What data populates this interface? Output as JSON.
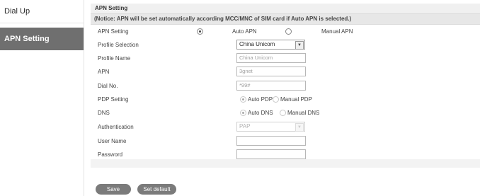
{
  "sidebar": {
    "items": [
      {
        "label": "Dial Up"
      },
      {
        "label": "APN Setting"
      }
    ]
  },
  "panel": {
    "title": "APN Setting",
    "notice": "(Notice: APN will be set automatically according MCC/MNC of SIM card if Auto APN is selected.)"
  },
  "form": {
    "apn_setting": {
      "label": "APN Setting",
      "options": [
        "Auto APN",
        "Manual APN"
      ],
      "selected": "Auto APN"
    },
    "profile_selection": {
      "label": "Profile Selection",
      "value": "China Unicom"
    },
    "profile_name": {
      "label": "Profile Name",
      "placeholder": "China Unicom"
    },
    "apn": {
      "label": "APN",
      "placeholder": "3gnet"
    },
    "dial_no": {
      "label": "Dial No.",
      "placeholder": "*99#"
    },
    "pdp_setting": {
      "label": "PDP Setting",
      "options": [
        "Auto PDP",
        "Manual PDP"
      ],
      "selected": "Auto PDP"
    },
    "dns": {
      "label": "DNS",
      "options": [
        "Auto DNS",
        "Manual DNS"
      ],
      "selected": "Auto DNS"
    },
    "authentication": {
      "label": "Authentication",
      "value": "PAP"
    },
    "user_name": {
      "label": "User Name",
      "value": ""
    },
    "password": {
      "label": "Password",
      "value": ""
    }
  },
  "buttons": {
    "save": "Save",
    "set_default": "Set default"
  },
  "colors": {
    "sidebar_active_bg": "#6f6f6f",
    "button_bg": "#7b7b7b"
  }
}
